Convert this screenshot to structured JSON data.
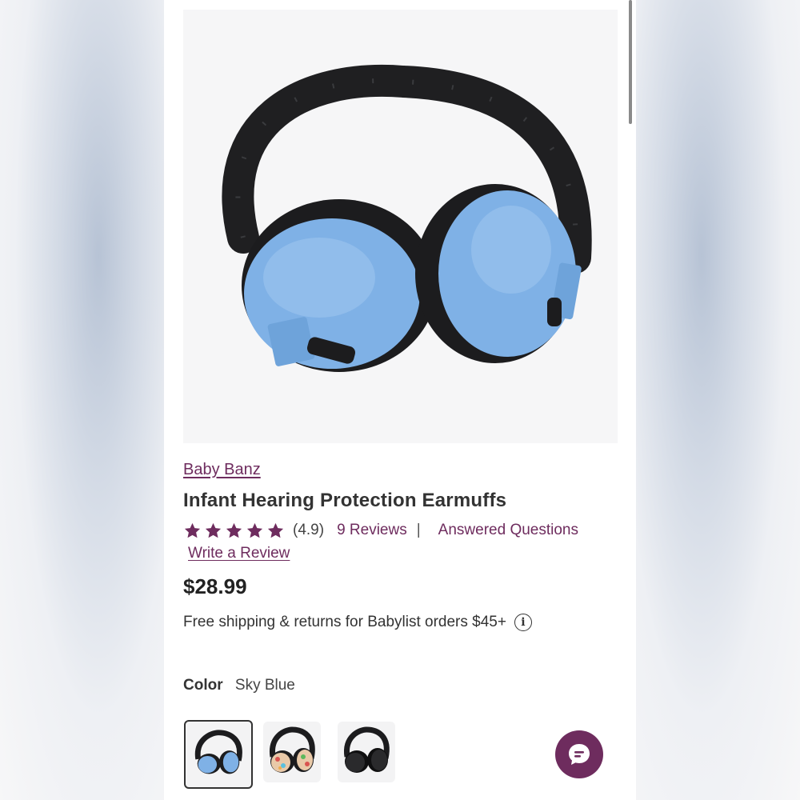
{
  "product": {
    "brand": "Baby Banz",
    "title": "Infant Hearing Protection Earmuffs",
    "rating": {
      "stars": 5,
      "value_text": "(4.9)"
    },
    "reviews_link": "9 Reviews",
    "separator": "|",
    "answered_questions_link": "Answered Questions",
    "write_review_link": "Write a Review",
    "price": "$28.99",
    "shipping_text": "Free shipping & returns for Babylist orders $45+",
    "color_label": "Color",
    "color_value": "Sky Blue",
    "swatches": [
      {
        "name": "Sky Blue",
        "selected": true
      },
      {
        "name": "pattern",
        "selected": false
      },
      {
        "name": "black",
        "selected": false
      }
    ]
  },
  "colors": {
    "accent": "#6e2c5e",
    "earcup_blue": "#7fb1e6",
    "text_dark": "#333333"
  },
  "icons": {
    "info": "info-circle-icon",
    "chat": "chat-bubble-icon",
    "star": "star-icon"
  }
}
